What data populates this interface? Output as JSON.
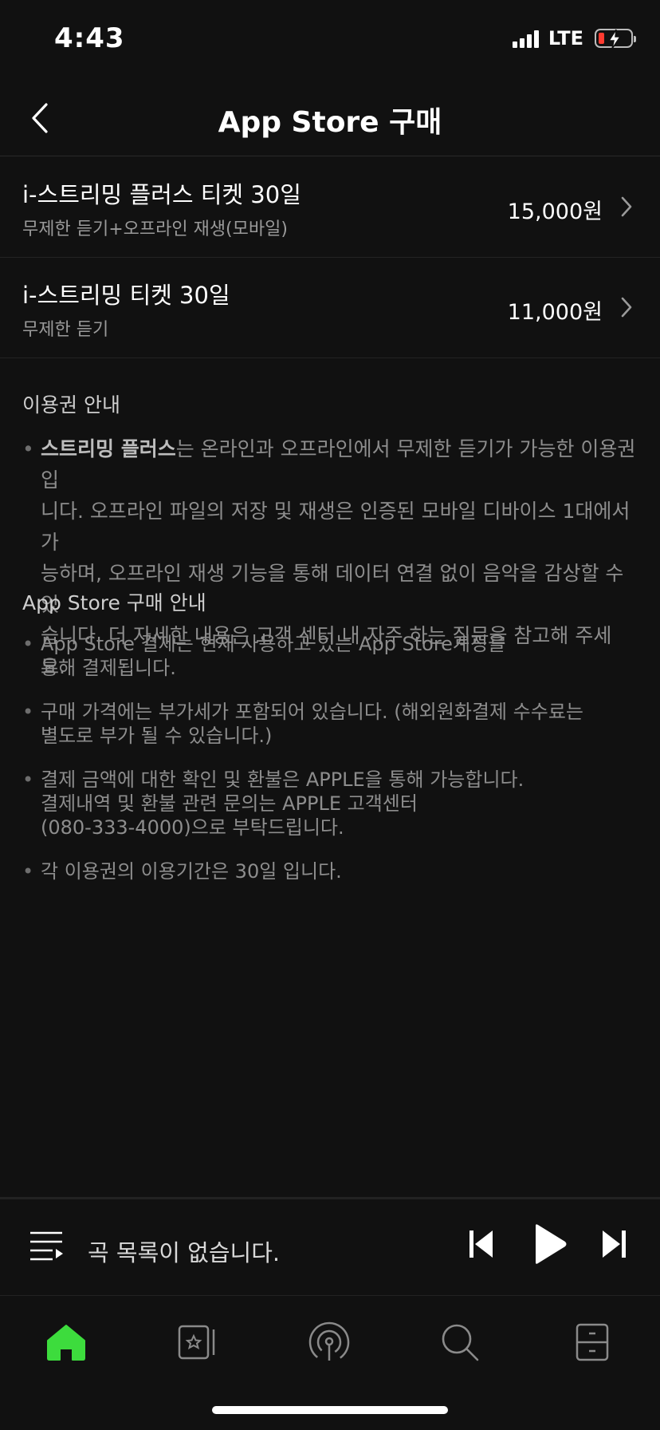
{
  "status_bar": {
    "time": "4:43",
    "network": "LTE",
    "battery_color": "#ff3b30"
  },
  "header": {
    "title": "App Store 구매",
    "back_icon": "chevron-left-icon"
  },
  "products": [
    {
      "name": "i-스트리밍 플러스 티켓 30일",
      "description": "무제한 듣기+오프라인 재생(모바일)",
      "price": "15,000원"
    },
    {
      "name": "i-스트리밍 티켓 30일",
      "description": "무제한 듣기",
      "price": "11,000원"
    }
  ],
  "pass_info": {
    "title": "이용권 안내",
    "highlight": "스트리밍 플러스",
    "lines": [
      "는 온라인과 오프라인에서 무제한 듣기가 가능한 이용권입",
      "니다. 오프라인 파일의 저장 및 재생은 인증된 모바일 디바이스 1대에서 가",
      "능하며, 오프라인 재생 기능을 통해 데이터 연결 없이 음악을 감상할 수 있",
      "습니다. 더 자세한 내용은 고객 센터 내 자주 하는 질문을 참고해 주세요."
    ]
  },
  "purchase_info": {
    "title": "App Store 구매 안내",
    "bullets": [
      [
        "App Store 결제는 현재 사용하고 있는 App Store계정을",
        "통해 결제됩니다."
      ],
      [
        "구매 가격에는 부가세가 포함되어 있습니다. (해외원화결제 수수료는",
        "별도로 부가 될 수 있습니다.)"
      ],
      [
        "결제 금액에 대한 확인 및 환불은 APPLE을 통해 가능합니다.",
        "결제내역 및 환불 관련 문의는 APPLE 고객센터",
        "(080-333-4000)으로 부탁드립니다."
      ],
      [
        "각 이용권의 이용기간은 30일 입니다."
      ]
    ]
  },
  "player": {
    "empty_text": "곡 목록이 없습니다."
  },
  "tabbar": {
    "active_color": "#3ddc3d",
    "tabs": [
      "home-icon",
      "library-icon",
      "podcast-icon",
      "search-icon",
      "more-icon"
    ]
  }
}
